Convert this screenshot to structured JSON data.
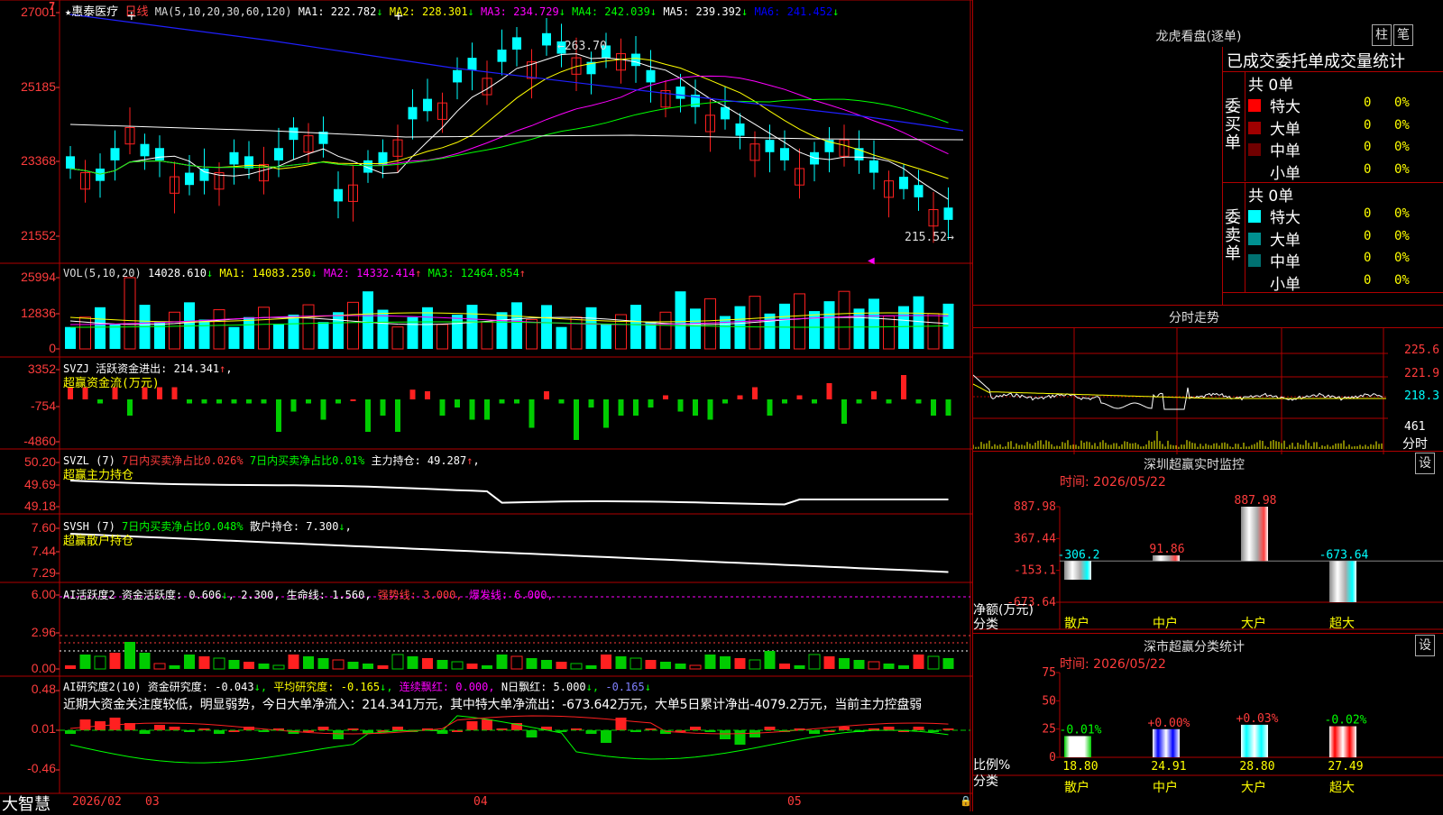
{
  "stock": {
    "name": "惠泰医疗",
    "period": "日线",
    "badge": "7"
  },
  "colors": {
    "up": "#ff2020",
    "down": "#00ffff",
    "green": "#00cc00",
    "grid": "#b00000",
    "ma1": "#ffffff",
    "ma2": "#ffff00",
    "ma3": "#ff00ff",
    "ma4": "#00ff00",
    "ma5": "#8080ff",
    "ma6": "#0000ff"
  },
  "main_chart": {
    "ma_header": "MA(5,10,20,30,60,120)",
    "ma_items": [
      {
        "label": "MA1: 222.782",
        "arrow": "↓",
        "color": "#ffffff"
      },
      {
        "label": "MA2: 228.301",
        "arrow": "↓",
        "color": "#ffff00"
      },
      {
        "label": "MA3: 234.729",
        "arrow": "↓",
        "color": "#ff00ff"
      },
      {
        "label": "MA4: 242.039",
        "arrow": "↓",
        "color": "#00ff00"
      },
      {
        "label": "MA5: 239.392",
        "arrow": "↓",
        "color": "#ffffff"
      },
      {
        "label": "MA6: 241.452",
        "arrow": "↓",
        "color": "#0000ff"
      }
    ],
    "y_ticks": [
      "27001",
      "25185",
      "23368",
      "21552"
    ],
    "high_label": "263.70",
    "low_label": "215.52"
  },
  "vol_panel": {
    "header": "VOL(5,10,20)",
    "items": [
      {
        "label": "14028.610",
        "arrow": "↓",
        "color": "#ffffff"
      },
      {
        "label": "MA1: 14083.250",
        "arrow": "↓",
        "color": "#ffff00"
      },
      {
        "label": "MA2: 14332.414",
        "arrow": "↑",
        "color": "#ff00ff"
      },
      {
        "label": "MA3: 12464.854",
        "arrow": "↑",
        "color": "#00ff00"
      }
    ],
    "y_ticks": [
      "25994",
      "12836",
      "0"
    ]
  },
  "svzj_panel": {
    "header": "SVZJ  活跃资金进出: 214.341",
    "arrow": "↑",
    "subtitle": "超赢资金流(万元)",
    "y_ticks": [
      "3352",
      "-754",
      "-4860"
    ]
  },
  "svzl_panel": {
    "header": "SVZL (7)",
    "item1": "7日内买卖净占比0.026%",
    "item2": "7日内买卖净占比0.01%",
    "item3": "主力持仓: 49.287",
    "arrow": "↑",
    "subtitle": "超赢主力持仓",
    "y_ticks": [
      "50.20",
      "49.69",
      "49.18"
    ]
  },
  "svsh_panel": {
    "header": "SVSH (7)",
    "item1": "7日内买卖净占比0.048%",
    "item2": "散户持仓: 7.300",
    "arrow": "↓",
    "subtitle": "超赢散户持仓",
    "y_ticks": [
      "7.60",
      "7.44",
      "7.29"
    ]
  },
  "ai_active_panel": {
    "header": "AI活跃度2 资金活跃度: 0.606",
    "item1": "2.300, 生命线: 1.560,",
    "item2": "强势线: 3.000,",
    "item3": "爆发线: 6.000,",
    "y_ticks": [
      "6.00",
      "2.96",
      "0.00"
    ]
  },
  "ai_research_panel": {
    "header": "AI研究度2(10) 资金研究度: -0.043",
    "item1": "平均研究度: -0.165",
    "item2": "连续飘红: 0.000,",
    "item3": "N日飘红: 5.000",
    "item4": "-0.165",
    "comment": "近期大资金关注度较低，明显弱势，今日大单净流入：214.341万元，其中特大单净流出：-673.642万元，大单5日累计净出-4079.2万元，当前主力控盘弱",
    "y_ticks": [
      "0.48",
      "0.01",
      "-0.46"
    ]
  },
  "bottom_bar": {
    "brand": "大智慧",
    "dates": [
      "2026/02",
      "03",
      "04",
      "05"
    ]
  },
  "right_panel": {
    "dragon_title": "龙虎看盘(逐单)",
    "btn_zhu": "柱",
    "btn_bi": "笔",
    "stats_title": "已成交委托单成交量统计",
    "buy_side": {
      "side_label": "委买单",
      "total": "共 0单",
      "rows": [
        {
          "name": "特大",
          "count": "0",
          "pct": "0%",
          "color": "#ff0000"
        },
        {
          "name": "大单",
          "count": "0",
          "pct": "0%",
          "color": "#a00000"
        },
        {
          "name": "中单",
          "count": "0",
          "pct": "0%",
          "color": "#700000"
        },
        {
          "name": "小单",
          "count": "0",
          "pct": "0%",
          "color": "#000000"
        }
      ]
    },
    "sell_side": {
      "side_label": "委卖单",
      "total": "共 0单",
      "rows": [
        {
          "name": "特大",
          "count": "0",
          "pct": "0%",
          "color": "#00ffff"
        },
        {
          "name": "大单",
          "count": "0",
          "pct": "0%",
          "color": "#009090"
        },
        {
          "name": "中单",
          "count": "0",
          "pct": "0%",
          "color": "#007070"
        },
        {
          "name": "小单",
          "count": "0",
          "pct": "0%",
          "color": "#000000"
        }
      ]
    },
    "intraday": {
      "title": "分时走势",
      "price_ticks": [
        "225.6",
        "221.9",
        "218.3"
      ],
      "vol_tick": "461",
      "vol_unit": "分时"
    },
    "monitor": {
      "title": "深圳超赢实时监控",
      "btn": "设",
      "time": "时间: 2026/05/22",
      "y_ticks": [
        "887.98",
        "367.44",
        "-153.1",
        "-673.64"
      ],
      "y_unit_1": "净额(万元)",
      "y_unit_2": "分类",
      "bars": [
        {
          "label": "散户",
          "value": -306.2,
          "text": "-306.2",
          "text_color": "#00ffff"
        },
        {
          "label": "中户",
          "value": 91.86,
          "text": "91.86",
          "text_color": "#ff3c3c"
        },
        {
          "label": "大户",
          "value": 887.98,
          "text": "887.98",
          "text_color": "#ff3c3c"
        },
        {
          "label": "超大",
          "value": -673.64,
          "text": "-673.64",
          "text_color": "#00ffff"
        }
      ]
    },
    "classify": {
      "title": "深市超赢分类统计",
      "btn": "设",
      "time": "时间: 2026/05/22",
      "y_ticks": [
        "75",
        "50",
        "25",
        "0"
      ],
      "y_unit_1": "比例%",
      "y_unit_2": "分类",
      "bars": [
        {
          "label": "散户",
          "value": 18.8,
          "text": "18.80",
          "pct": "-0.01%",
          "pct_color": "#00ff00",
          "c1": "#ffffff",
          "c2": "#00cc00"
        },
        {
          "label": "中户",
          "value": 24.91,
          "text": "24.91",
          "pct": "+0.00%",
          "pct_color": "#ff3c3c",
          "c1": "#0000ff",
          "c2": "#ffffff"
        },
        {
          "label": "大户",
          "value": 28.8,
          "text": "28.80",
          "pct": "+0.03%",
          "pct_color": "#ff3c3c",
          "c1": "#00ffff",
          "c2": "#ffffff"
        },
        {
          "label": "超大",
          "value": 27.49,
          "text": "27.49",
          "pct": "-0.02%",
          "pct_color": "#00ff00",
          "c1": "#ff0000",
          "c2": "#ffffff"
        }
      ]
    }
  }
}
